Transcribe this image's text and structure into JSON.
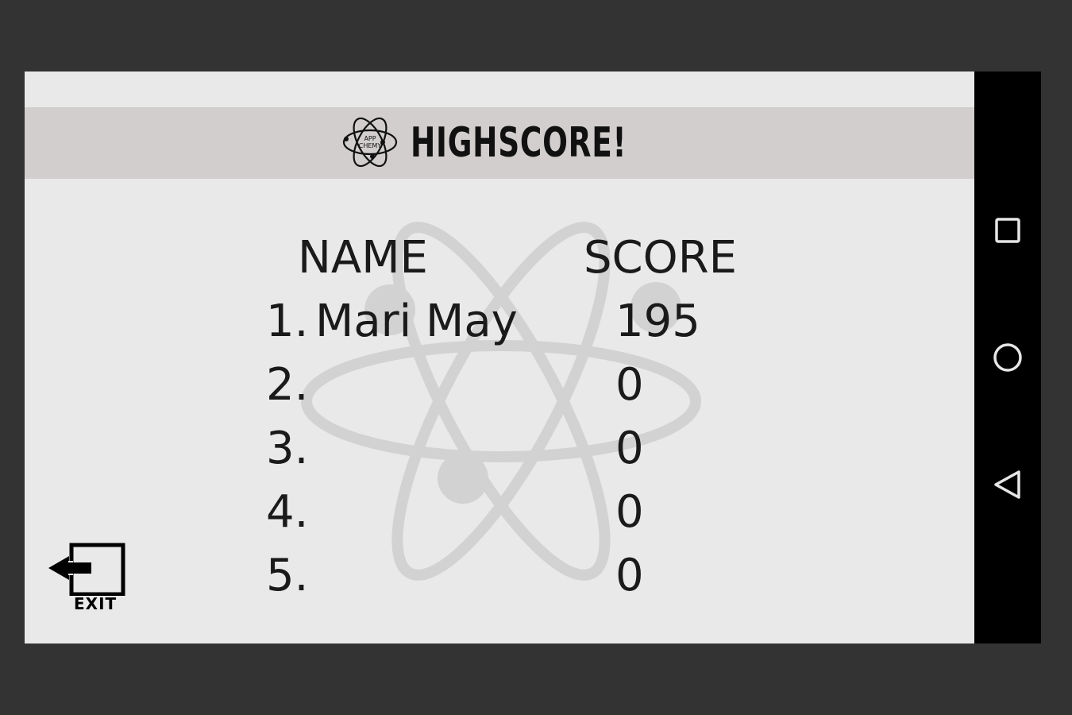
{
  "title": "HIGHSCORE!",
  "logo": {
    "line1": "APP",
    "line2": "CHEMY"
  },
  "columns": {
    "name": "NAME",
    "score": "SCORE"
  },
  "rows": [
    {
      "rank": "1.",
      "name": "Mari May",
      "score": "195"
    },
    {
      "rank": "2.",
      "name": "",
      "score": "0"
    },
    {
      "rank": "3.",
      "name": "",
      "score": "0"
    },
    {
      "rank": "4.",
      "name": "",
      "score": "0"
    },
    {
      "rank": "5.",
      "name": "",
      "score": "0"
    }
  ],
  "exit": {
    "label": "EXIT",
    "icon": "exit-door-icon"
  },
  "nav": {
    "recents_icon": "square-icon",
    "home_icon": "circle-icon",
    "back_icon": "triangle-back-icon"
  },
  "colors": {
    "background": "#333333",
    "screen": "#e9e9e9",
    "title_bar": "#d1cecd",
    "navbar": "#000000",
    "watermark": "#cfcfcf"
  }
}
